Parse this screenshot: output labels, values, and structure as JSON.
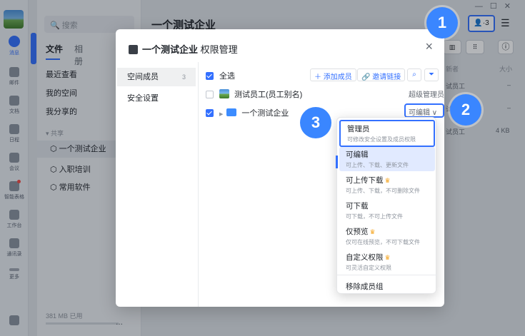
{
  "window": {
    "title": "一个测试企业",
    "controls": [
      "—",
      "☐",
      "✕"
    ]
  },
  "rail": {
    "items": [
      {
        "label": "消息",
        "icon": "chat-icon",
        "active": true
      },
      {
        "label": "邮件",
        "icon": "mail-icon"
      },
      {
        "label": "文档",
        "icon": "doc-icon"
      },
      {
        "label": "日程",
        "icon": "calendar-icon"
      },
      {
        "label": "会议",
        "icon": "meeting-icon"
      },
      {
        "label": "智能表格",
        "icon": "sheet-icon",
        "badge": true
      },
      {
        "label": "工作台",
        "icon": "workbench-icon"
      },
      {
        "label": "通讯录",
        "icon": "contacts-icon"
      },
      {
        "label": "更多",
        "icon": "more-icon"
      },
      {
        "label": "",
        "icon": "stats-icon"
      }
    ]
  },
  "files": {
    "search_placeholder": "搜索",
    "tabs": [
      "文件",
      "相册"
    ],
    "nav": [
      "最近查看",
      "我的空间",
      "我分享的"
    ],
    "share_header": "共享",
    "shared": [
      "一个测试企业",
      "入职培训",
      "常用软件"
    ],
    "storage": "381 MB 已用",
    "more": "..."
  },
  "main": {
    "title": "一个测试企业",
    "member_count": "3",
    "columns": [
      "新者",
      "大小"
    ],
    "rows": [
      {
        "owner": "试员工",
        "size": "–"
      },
      {
        "owner": "试员工",
        "size": "–"
      },
      {
        "owner": "试员工",
        "size": "4 KB"
      }
    ]
  },
  "dialog": {
    "title_bold": "一个测试企业",
    "title_rest": "权限管理",
    "close": "×",
    "side": [
      {
        "label": "空间成员",
        "count": "3"
      },
      {
        "label": "安全设置",
        "count": ""
      }
    ],
    "select_all": "全选",
    "add_member": "＋ 添加成员",
    "invite_link": "🔗 邀请链接",
    "members": [
      {
        "name": "测试员工(员工别名)",
        "role": "超级管理员",
        "checked": false
      },
      {
        "name": "一个测试企业",
        "role": "可编辑 ∨",
        "checked": true
      }
    ]
  },
  "dropdown": {
    "options": [
      {
        "title": "管理员",
        "desc": "可修改安全设置及成员权限",
        "crown": false
      },
      {
        "title": "可编辑",
        "desc": "可上传、下载、更新文件",
        "crown": false
      },
      {
        "title": "可上传下载",
        "desc": "可上传、下载，不可删除文件",
        "crown": true
      },
      {
        "title": "可下载",
        "desc": "可下载，不可上传文件",
        "crown": false
      },
      {
        "title": "仅预览",
        "desc": "仅可在线预览，不可下载文件",
        "crown": true
      },
      {
        "title": "自定义权限",
        "desc": "可灵活自定义权限",
        "crown": true
      }
    ],
    "remove": "移除成员组"
  },
  "callouts": [
    "1",
    "2",
    "3"
  ]
}
